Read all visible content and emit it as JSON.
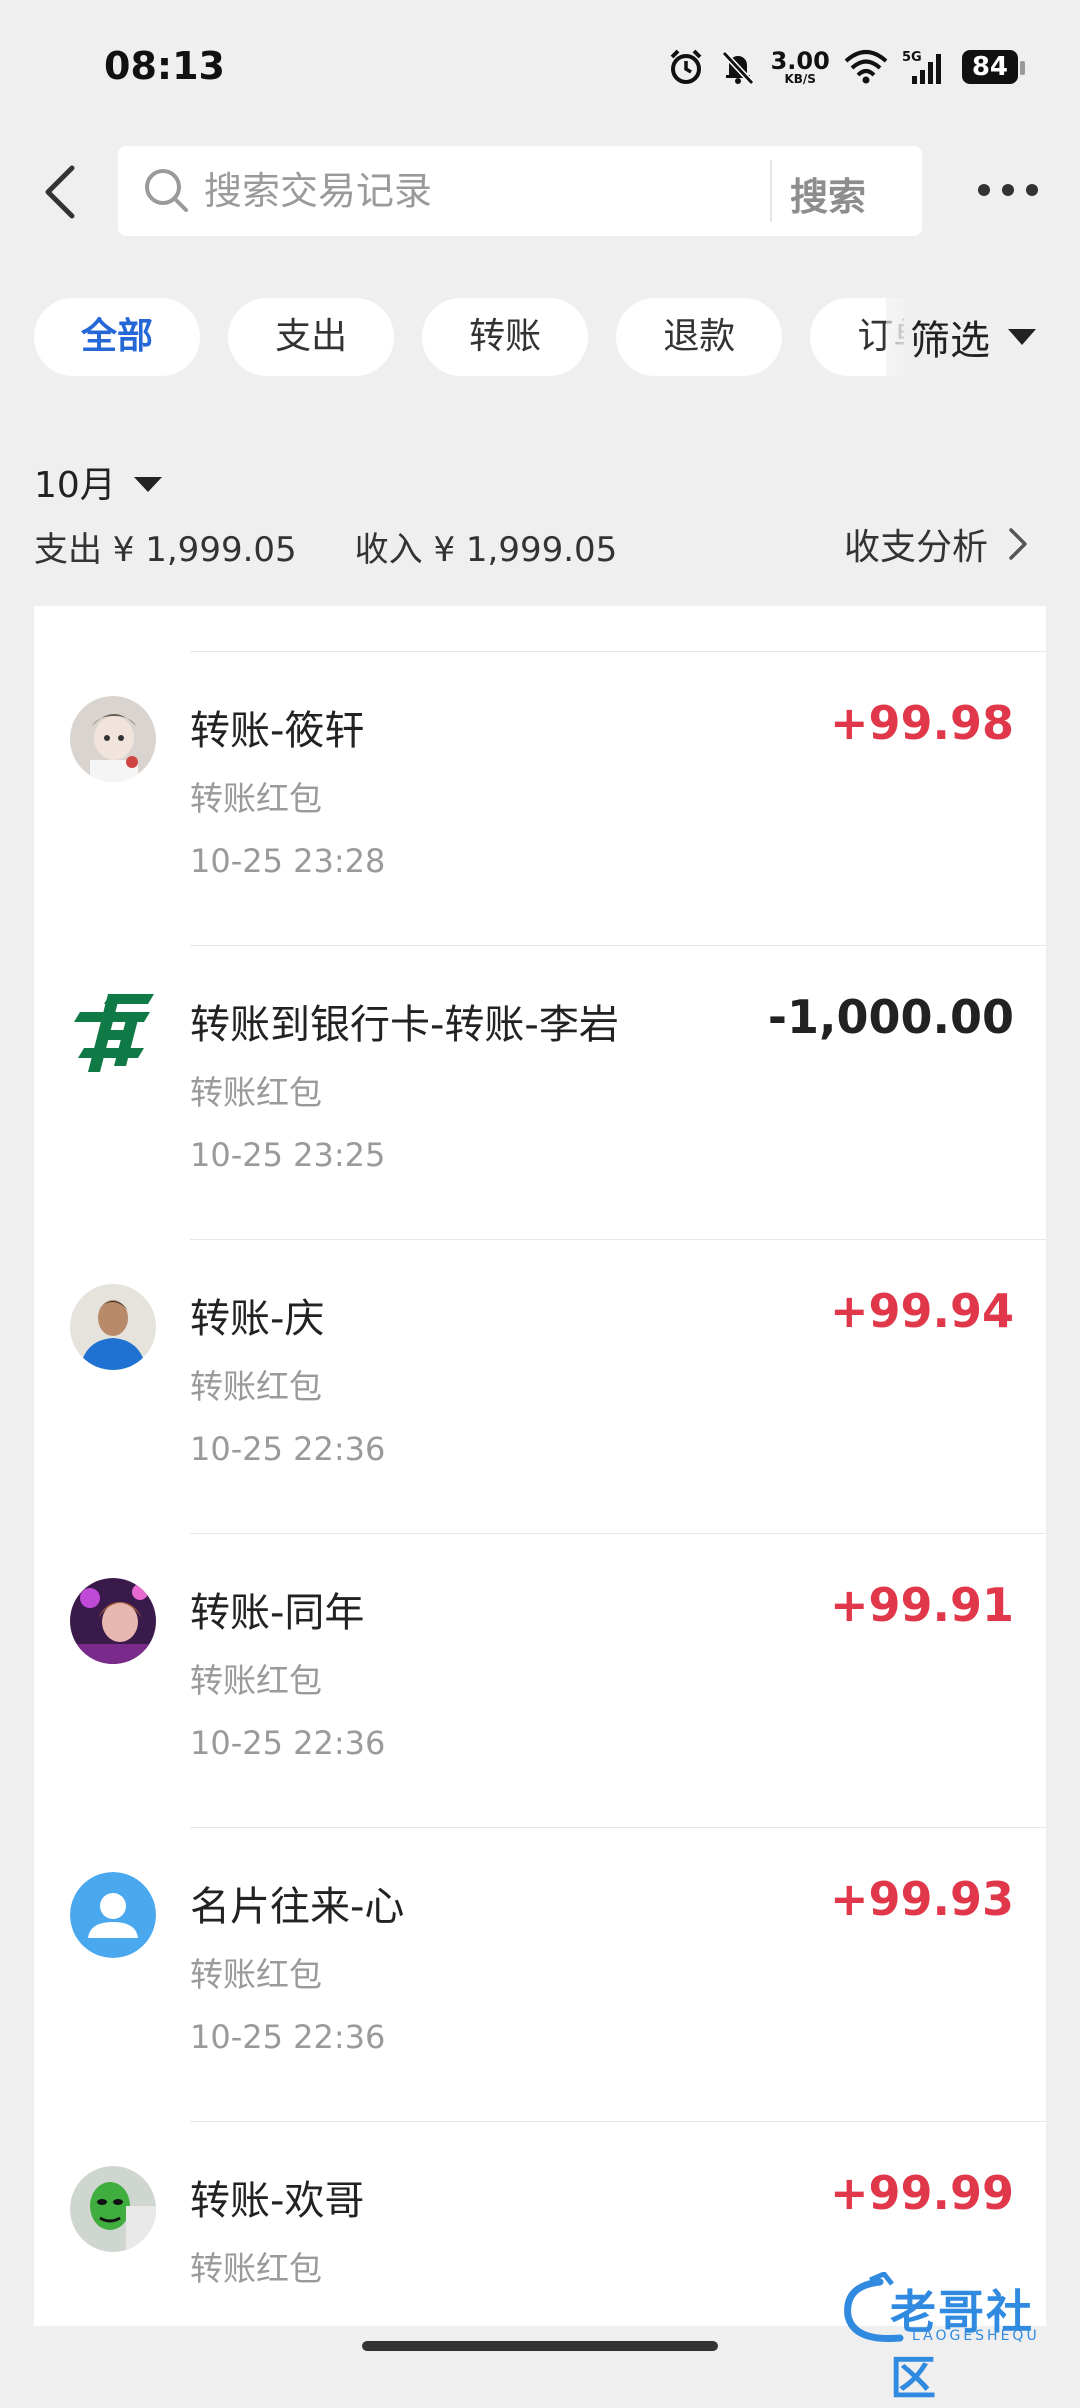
{
  "status_bar": {
    "time": "08:13",
    "net_speed": "3.00",
    "net_unit": "KB/S",
    "network": "5G",
    "battery": "84"
  },
  "header": {
    "search_placeholder": "搜索交易记录",
    "search_button": "搜索"
  },
  "tabs": [
    {
      "label": "全部",
      "active": true
    },
    {
      "label": "支出",
      "active": false
    },
    {
      "label": "转账",
      "active": false
    },
    {
      "label": "退款",
      "active": false
    },
    {
      "label": "订单",
      "active": false
    }
  ],
  "filter_label": "筛选",
  "month": {
    "label": "10月",
    "expense": "支出 ¥ 1,999.05",
    "income": "收入 ¥ 1,999.05",
    "analysis_label": "收支分析"
  },
  "transactions": [
    {
      "title": "转账-筱轩",
      "subtitle": "转账红包",
      "date": "10-25 23:28",
      "amount": "+99.98",
      "type": "pos",
      "avatar": "photo-avatar-child"
    },
    {
      "title": "转账到银行卡-转账-李岩",
      "subtitle": "转账红包",
      "date": "10-25 23:25",
      "amount": "-1,000.00",
      "type": "neg",
      "avatar": "postal-bank-logo"
    },
    {
      "title": "转账-庆",
      "subtitle": "转账红包",
      "date": "10-25 22:36",
      "amount": "+99.94",
      "type": "pos",
      "avatar": "photo-avatar-man"
    },
    {
      "title": "转账-同年",
      "subtitle": "转账红包",
      "date": "10-25 22:36",
      "amount": "+99.91",
      "type": "pos",
      "avatar": "photo-avatar-stage"
    },
    {
      "title": "名片往来-心",
      "subtitle": "转账红包",
      "date": "10-25 22:36",
      "amount": "+99.93",
      "type": "pos",
      "avatar": "default-user-avatar"
    },
    {
      "title": "转账-欢哥",
      "subtitle": "转账红包",
      "date": "",
      "amount": "+99.99",
      "type": "pos",
      "avatar": "photo-avatar-mask"
    }
  ],
  "watermark": {
    "text": "老哥社区",
    "sub": "LAOGESHEQU"
  },
  "colors": {
    "accent": "#2567d6",
    "income": "#e0384a",
    "background": "#efefef"
  }
}
